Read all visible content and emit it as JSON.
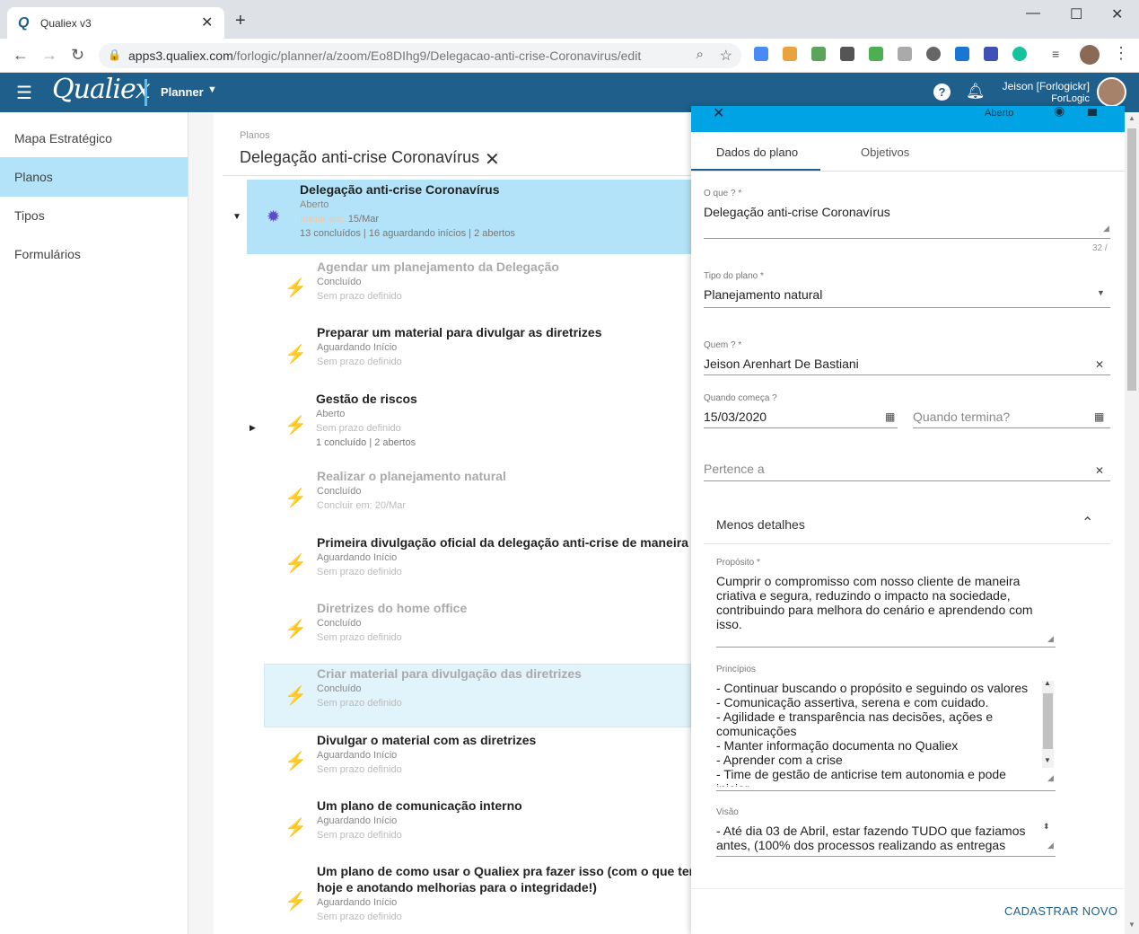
{
  "browser": {
    "tab_title": "Qualiex v3",
    "tab_favicon": "Q",
    "url_domain": "apps3.qualiex.com",
    "url_path": "/forlogic/planner/a/zoom/Eo8DIhg9/Delegacao-anti-crise-Coronavirus/edit"
  },
  "app": {
    "brand": "Qualiex",
    "module": "Planner",
    "user_name": "Jeison [Forlogickr]",
    "user_org": "ForLogic",
    "help_glyph": "?",
    "accent_color": "#1f5f8b"
  },
  "sidebar": {
    "items": [
      {
        "label": "Mapa Estratégico"
      },
      {
        "label": "Planos"
      },
      {
        "label": "Tipos"
      },
      {
        "label": "Formulários"
      }
    ]
  },
  "board": {
    "breadcrumb": "Planos",
    "title": "Delegação anti-crise Coronavírus",
    "root": {
      "title": "Delegação anti-crise Coronavírus",
      "status": "Aberto",
      "date_prefix": "Iniciar em:",
      "date": "15/Mar",
      "summary": "13 concluídos | 16 aguardando inícios | 2 abertos"
    },
    "items": [
      {
        "title": "Agendar um planejamento da Delegação",
        "status": "Concluído",
        "deadline": "Sem prazo definido"
      },
      {
        "title": "Preparar um material para divulgar as diretrizes",
        "status": "Aguardando Início",
        "deadline": "Sem prazo definido"
      },
      {
        "title": "Gestão de riscos",
        "status": "Aberto",
        "deadline": "Sem prazo definido",
        "summary": "1 concluído | 2 abertos"
      },
      {
        "title": "Realizar o planejamento natural",
        "status": "Concluído",
        "deadline": "Concluir em: 20/Mar"
      },
      {
        "title": "Primeira divulgação oficial da delegação anti-crise de maneira ex",
        "status": "Aguardando Início",
        "deadline": "Sem prazo definido"
      },
      {
        "title": "Diretrizes do home office",
        "status": "Concluído",
        "deadline": "Sem prazo definido"
      },
      {
        "title": "Criar material para divulgação das diretrizes",
        "status": "Concluído",
        "deadline": "Sem prazo definido"
      },
      {
        "title": "Divulgar o material com as diretrizes",
        "status": "Aguardando Início",
        "deadline": "Sem prazo definido"
      },
      {
        "title": "Um plano de comunicação interno",
        "status": "Aguardando Início",
        "deadline": "Sem prazo definido"
      },
      {
        "title": "Um plano de como usar o Qualiex pra fazer isso (com o que temo",
        "title2": "hoje e anotando melhorias para o integridade!)",
        "status": "Aguardando Início",
        "deadline": "Sem prazo definido"
      }
    ]
  },
  "panel": {
    "top_status": "Aberto",
    "tabs": [
      "Dados do plano",
      "Objetivos"
    ],
    "o_que_label": "O que ? *",
    "o_que_value": "Delegação anti-crise Coronavírus",
    "o_que_counter": "32 /",
    "tipo_label": "Tipo do plano *",
    "tipo_value": "Planejamento natural",
    "quem_label": "Quem ? *",
    "quem_value": "Jeison Arenhart De Bastiani",
    "comeca_label": "Quando começa ?",
    "comeca_value": "15/03/2020",
    "termina_placeholder": "Quando termina?",
    "pertence_placeholder": "Pertence a",
    "details_toggle": "Menos detalhes",
    "proposito_label": "Propósito *",
    "proposito_value": "Cumprir o compromisso com nosso cliente de maneira criativa e segura, reduzindo o impacto na sociedade, contribuindo para melhora do cenário e aprendendo com isso.",
    "principios_label": "Princípios",
    "principios_value": "- Continuar buscando o propósito e seguindo os valores\n- Comunicação assertiva, serena e com cuidado.\n- Agilidade e transparência nas decisões, ações e comunicações\n- Manter informação documenta no Qualiex\n- Aprender com a crise\n- Time de gestão de anticrise tem autonomia e pode iniciar",
    "visao_label": "Visão",
    "visao_value": "- Até dia 03 de Abril, estar fazendo TUDO que faziamos antes, (100% dos processos realizando as entregas",
    "save_new": "CADASTRAR NOVO"
  }
}
